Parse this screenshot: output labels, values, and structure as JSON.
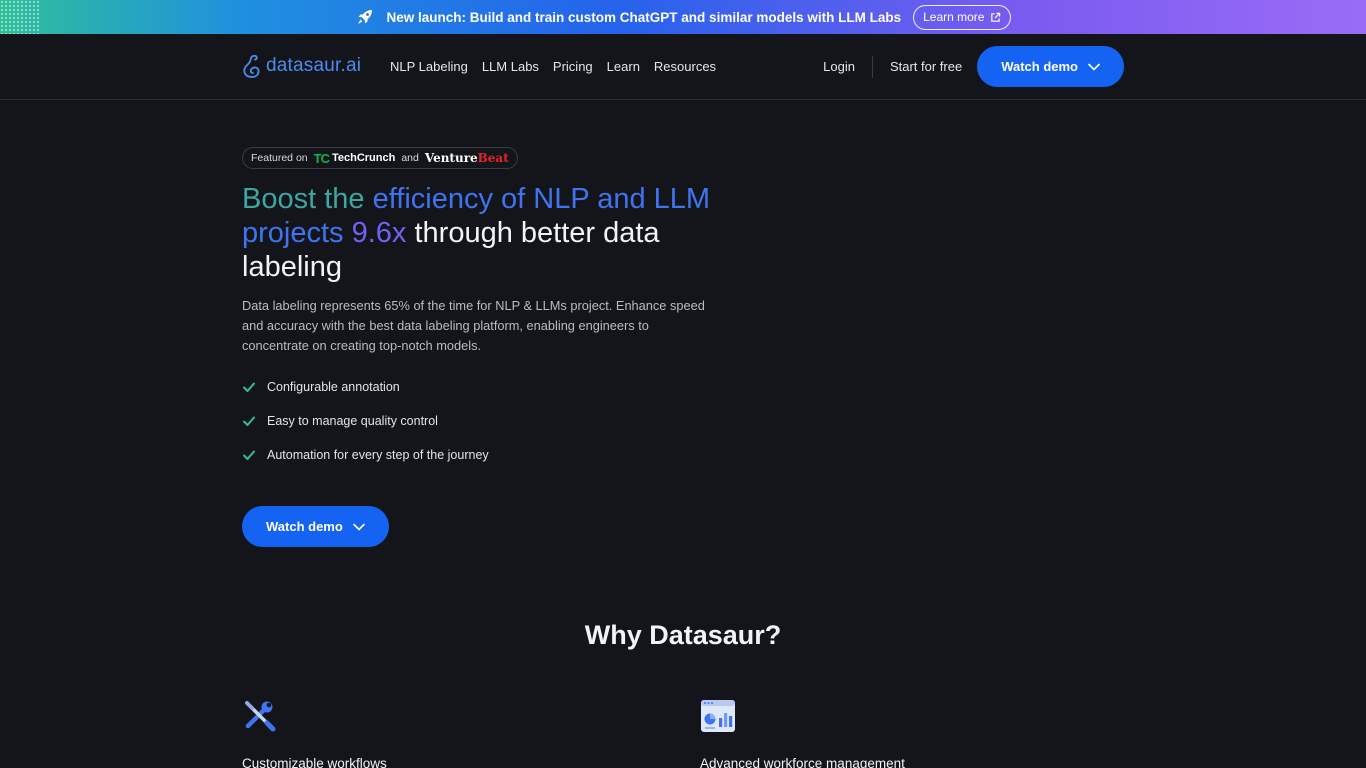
{
  "banner": {
    "icon": "rocket-icon",
    "text": "New launch: Build and train custom ChatGPT and similar models with LLM Labs",
    "button_label": "Learn more",
    "button_icon": "external-link-icon"
  },
  "nav": {
    "logo_text": "datasaur.ai",
    "links": [
      "NLP Labeling",
      "LLM Labs",
      "Pricing",
      "Learn",
      "Resources"
    ],
    "login": "Login",
    "start": "Start for free",
    "demo": "Watch demo"
  },
  "hero": {
    "featured_prefix": "Featured on",
    "tc_logo": "TC",
    "tc_name": "TechCrunch",
    "and": "and",
    "vb_venture": "Venture",
    "vb_beat": "Beat",
    "title_a": "Boost the ",
    "title_b": "efficiency of NLP and LLM projects ",
    "title_c": "9.6x",
    "title_d": " through better data labeling",
    "description": "Data labeling represents 65% of the time for NLP & LLMs project. Enhance speed and accuracy with the best data labeling platform, enabling engineers to concentrate on creating top-notch models.",
    "checks": [
      "Configurable annotation",
      "Easy to manage quality control",
      "Automation for every step of the journey"
    ],
    "cta": "Watch demo"
  },
  "why": {
    "title": "Why Datasaur?",
    "features": [
      {
        "title": "Customizable workflows",
        "icon": "wrench-screwdriver-icon"
      },
      {
        "title": "Advanced workforce management",
        "icon": "dashboard-chart-icon"
      }
    ]
  },
  "colors": {
    "accent": "#1463f3",
    "background": "#14151b",
    "check": "#2fbf9a"
  }
}
